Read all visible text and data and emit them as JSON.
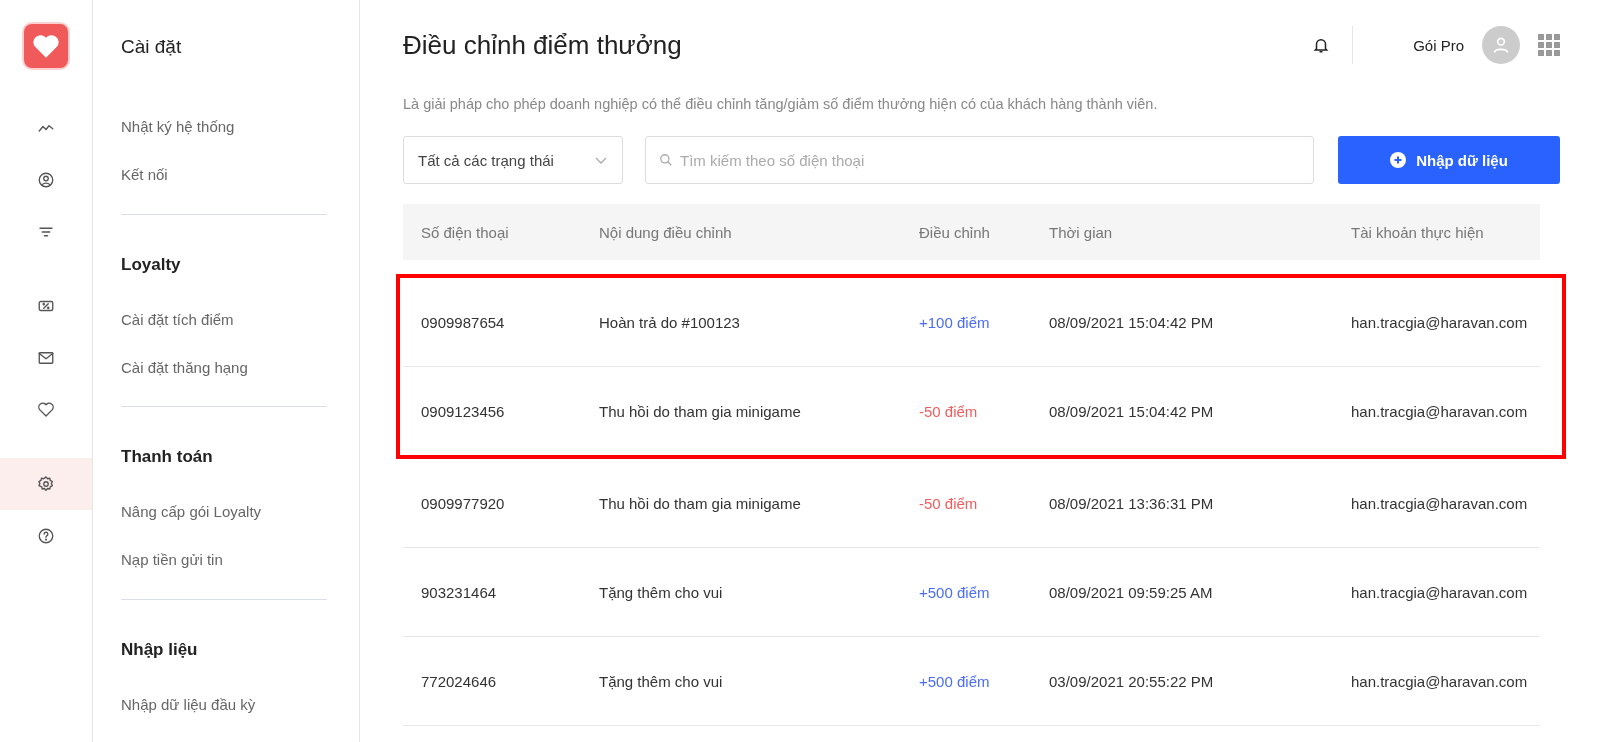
{
  "rail": {
    "items": [
      {
        "kind": "trend",
        "selected": false
      },
      {
        "kind": "user",
        "selected": false
      },
      {
        "kind": "filter",
        "selected": false
      },
      {
        "kind": "ticket",
        "selected": false
      },
      {
        "kind": "mail",
        "selected": false
      },
      {
        "kind": "heart",
        "selected": false
      },
      {
        "kind": "gear",
        "selected": true
      },
      {
        "kind": "help",
        "selected": false
      }
    ]
  },
  "sidebar": {
    "title": "Cài đặt",
    "sections": [
      {
        "items": [
          "Nhật ký hệ thống",
          "Kết nối"
        ]
      },
      {
        "heading": "Loyalty",
        "items": [
          "Cài đặt tích điểm",
          "Cài đặt thăng hạng"
        ]
      },
      {
        "heading": "Thanh toán",
        "items": [
          "Nâng cấp gói Loyalty",
          "Nạp tiền gửi tin"
        ]
      },
      {
        "heading": "Nhập liệu",
        "items": [
          "Nhập dữ liệu đầu kỳ"
        ]
      }
    ]
  },
  "header": {
    "title": "Điều chỉnh điểm thưởng",
    "plan": "Gói Pro"
  },
  "description": "Là giải pháp cho phép doanh nghiệp có thể điều chỉnh tăng/giảm số điểm thưởng hiện có của khách hàng thành viên.",
  "filter": {
    "value": "Tất cả các trạng thái"
  },
  "search": {
    "placeholder": "Tìm kiếm theo số điện thoại"
  },
  "import_button": "Nhập dữ liệu",
  "table": {
    "columns": [
      "Số điện thoại",
      "Nội dung điều chỉnh",
      "Điều chỉnh",
      "Thời gian",
      "Tài khoản thực hiện"
    ],
    "rows": [
      {
        "phone": "0909987654",
        "content": "Hoàn trả do #100123",
        "adjust": "+100 điểm",
        "kind": "plus",
        "time": "08/09/2021 15:04:42 PM",
        "account": "han.tracgia@haravan.com",
        "highlighted": true
      },
      {
        "phone": "0909123456",
        "content": "Thu hồi do tham gia minigame",
        "adjust": "-50 điểm",
        "kind": "minus",
        "time": "08/09/2021 15:04:42 PM",
        "account": "han.tracgia@haravan.com",
        "highlighted": true
      },
      {
        "phone": "0909977920",
        "content": "Thu hồi do tham gia minigame",
        "adjust": "-50 điểm",
        "kind": "minus",
        "time": "08/09/2021 13:36:31 PM",
        "account": "han.tracgia@haravan.com",
        "highlighted": false
      },
      {
        "phone": "903231464",
        "content": "Tặng thêm cho vui",
        "adjust": "+500 điểm",
        "kind": "plus",
        "time": "08/09/2021 09:59:25 AM",
        "account": "han.tracgia@haravan.com",
        "highlighted": false
      },
      {
        "phone": "772024646",
        "content": "Tặng thêm cho vui",
        "adjust": "+500 điểm",
        "kind": "plus",
        "time": "03/09/2021 20:55:22 PM",
        "account": "han.tracgia@haravan.com",
        "highlighted": false
      }
    ]
  }
}
